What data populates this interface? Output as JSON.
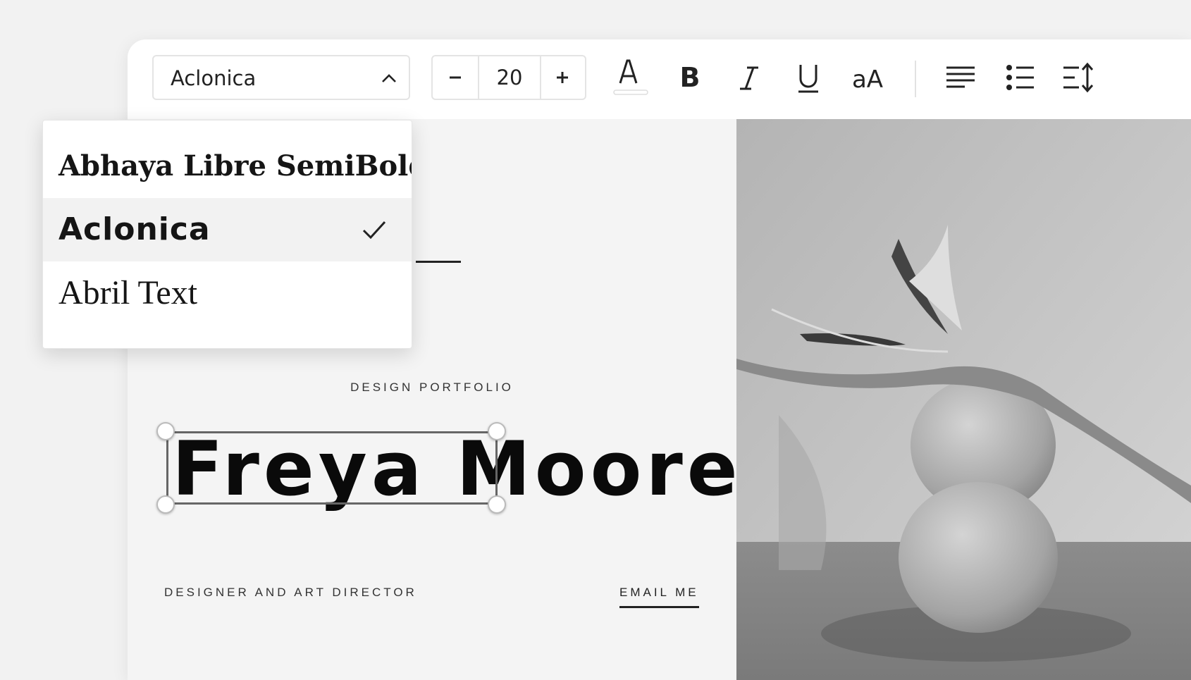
{
  "toolbar": {
    "font_selected": "Aclonica",
    "font_size": "20",
    "icons": [
      "chevron-up-icon",
      "minus-icon",
      "plus-icon",
      "text-color-icon",
      "bold-icon",
      "italic-icon",
      "underline-icon",
      "case-toggle-icon",
      "align-left-icon",
      "bulleted-list-icon",
      "line-spacing-icon"
    ]
  },
  "font_menu": {
    "options": [
      {
        "label": "Abhaya Libre SemiBold",
        "selected": false
      },
      {
        "label": "Aclonica",
        "selected": true
      },
      {
        "label": "Abril Text",
        "selected": false
      }
    ]
  },
  "canvas": {
    "kicker": "DESIGN PORTFOLIO",
    "headline": "Freya Moore",
    "subtitle": "DESIGNER AND ART DIRECTOR",
    "email_link": "EMAIL ME"
  },
  "colors": {
    "text": "#0a0a0a",
    "toolbar_bg": "#ffffff",
    "canvas_bg": "#f4f4f4",
    "selected_option_bg": "#f2f2f2"
  }
}
